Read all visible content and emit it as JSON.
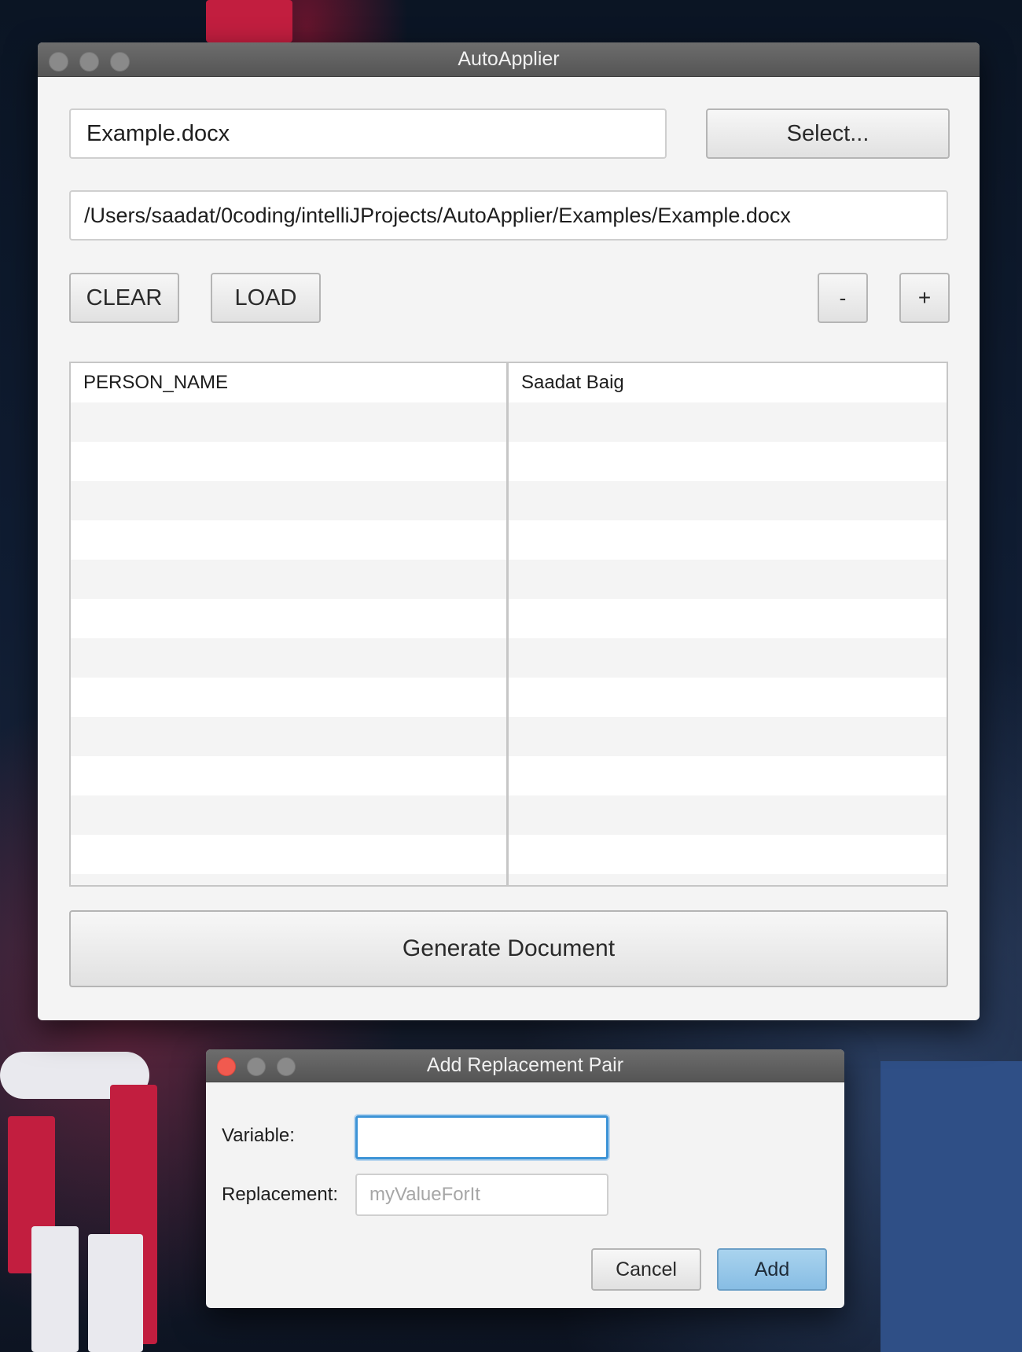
{
  "main_window": {
    "title": "AutoApplier",
    "file_name": "Example.docx",
    "select_label": "Select...",
    "file_path": "/Users/saadat/0coding/intelliJProjects/AutoApplier/Examples/Example.docx",
    "clear_label": "CLEAR",
    "load_label": "LOAD",
    "minus_label": "-",
    "plus_label": "+",
    "table": {
      "rows": [
        {
          "variable": "PERSON_NAME",
          "replacement": "Saadat Baig"
        }
      ]
    },
    "generate_label": "Generate Document"
  },
  "dialog": {
    "title": "Add Replacement Pair",
    "variable_label": "Variable:",
    "variable_value": "",
    "replacement_label": "Replacement:",
    "replacement_placeholder": "myValueForIt",
    "cancel_label": "Cancel",
    "add_label": "Add"
  },
  "colors": {
    "accent_focus": "#3c93d6",
    "default_button": "#87bde4",
    "close_red": "#f15a4f"
  }
}
